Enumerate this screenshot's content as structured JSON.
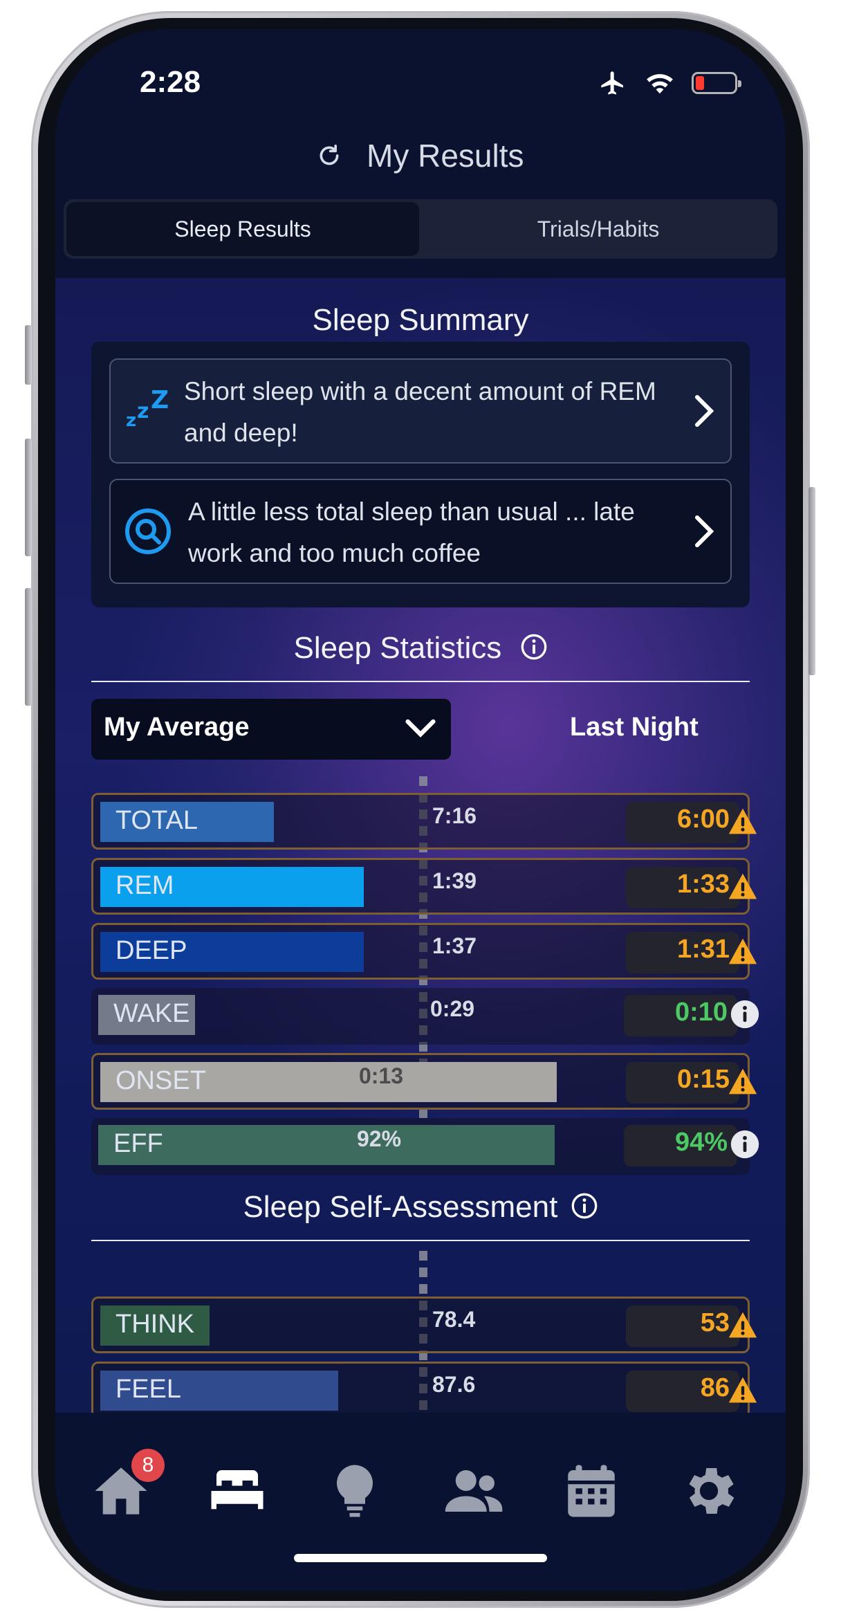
{
  "status_bar": {
    "time": "2:28"
  },
  "header": {
    "title": "My Results"
  },
  "tabs": {
    "sleep_results": "Sleep Results",
    "trials_habits": "Trials/Habits"
  },
  "summary": {
    "title": "Sleep Summary",
    "items": [
      {
        "text": "Short sleep with a decent amount of REM and deep!",
        "icon": "zzz-icon"
      },
      {
        "text": "A little less total sleep than usual ... late work and too much coffee",
        "icon": "search-icon"
      }
    ]
  },
  "statistics": {
    "title": "Sleep Statistics",
    "dropdown_label": "My Average",
    "last_night_label": "Last Night",
    "rows": [
      {
        "label": "TOTAL",
        "average": "7:16",
        "last": "6:00",
        "status": "warning",
        "bar_fraction": 0.27,
        "color": "#2c67b0"
      },
      {
        "label": "REM",
        "average": "1:39",
        "last": "1:33",
        "status": "warning",
        "bar_fraction": 0.41,
        "color": "#0aa0ee"
      },
      {
        "label": "DEEP",
        "average": "1:37",
        "last": "1:31",
        "status": "warning",
        "bar_fraction": 0.41,
        "color": "#0d3d9a"
      },
      {
        "label": "WAKE",
        "average": "0:29",
        "last": "0:10",
        "status": "info",
        "bar_fraction": 0.15,
        "color": "#737a8a"
      },
      {
        "label": "ONSET",
        "average": "0:13",
        "last": "0:15",
        "status": "warning",
        "bar_fraction": 0.71,
        "color": "#a9a7a3"
      },
      {
        "label": "EFF",
        "average": "92%",
        "last": "94%",
        "status": "info",
        "bar_fraction": 0.71,
        "color": "#3d6b5e"
      }
    ]
  },
  "self_assessment": {
    "title": "Sleep Self-Assessment",
    "rows": [
      {
        "label": "THINK",
        "average": "78.4",
        "last": "53",
        "status": "warning",
        "bar_fraction": 0.17,
        "color": "#2f5b44"
      },
      {
        "label": "FEEL",
        "average": "87.6",
        "last": "86",
        "status": "warning",
        "bar_fraction": 0.37,
        "color": "#314b8f"
      }
    ]
  },
  "tabbar": {
    "home_badge": "8",
    "items": [
      "home-icon",
      "bed-icon",
      "lightbulb-icon",
      "people-icon",
      "calendar-icon",
      "gear-icon"
    ]
  },
  "colors": {
    "warning": "#f5a623",
    "good": "#4cc865",
    "background": "#0a1230"
  }
}
